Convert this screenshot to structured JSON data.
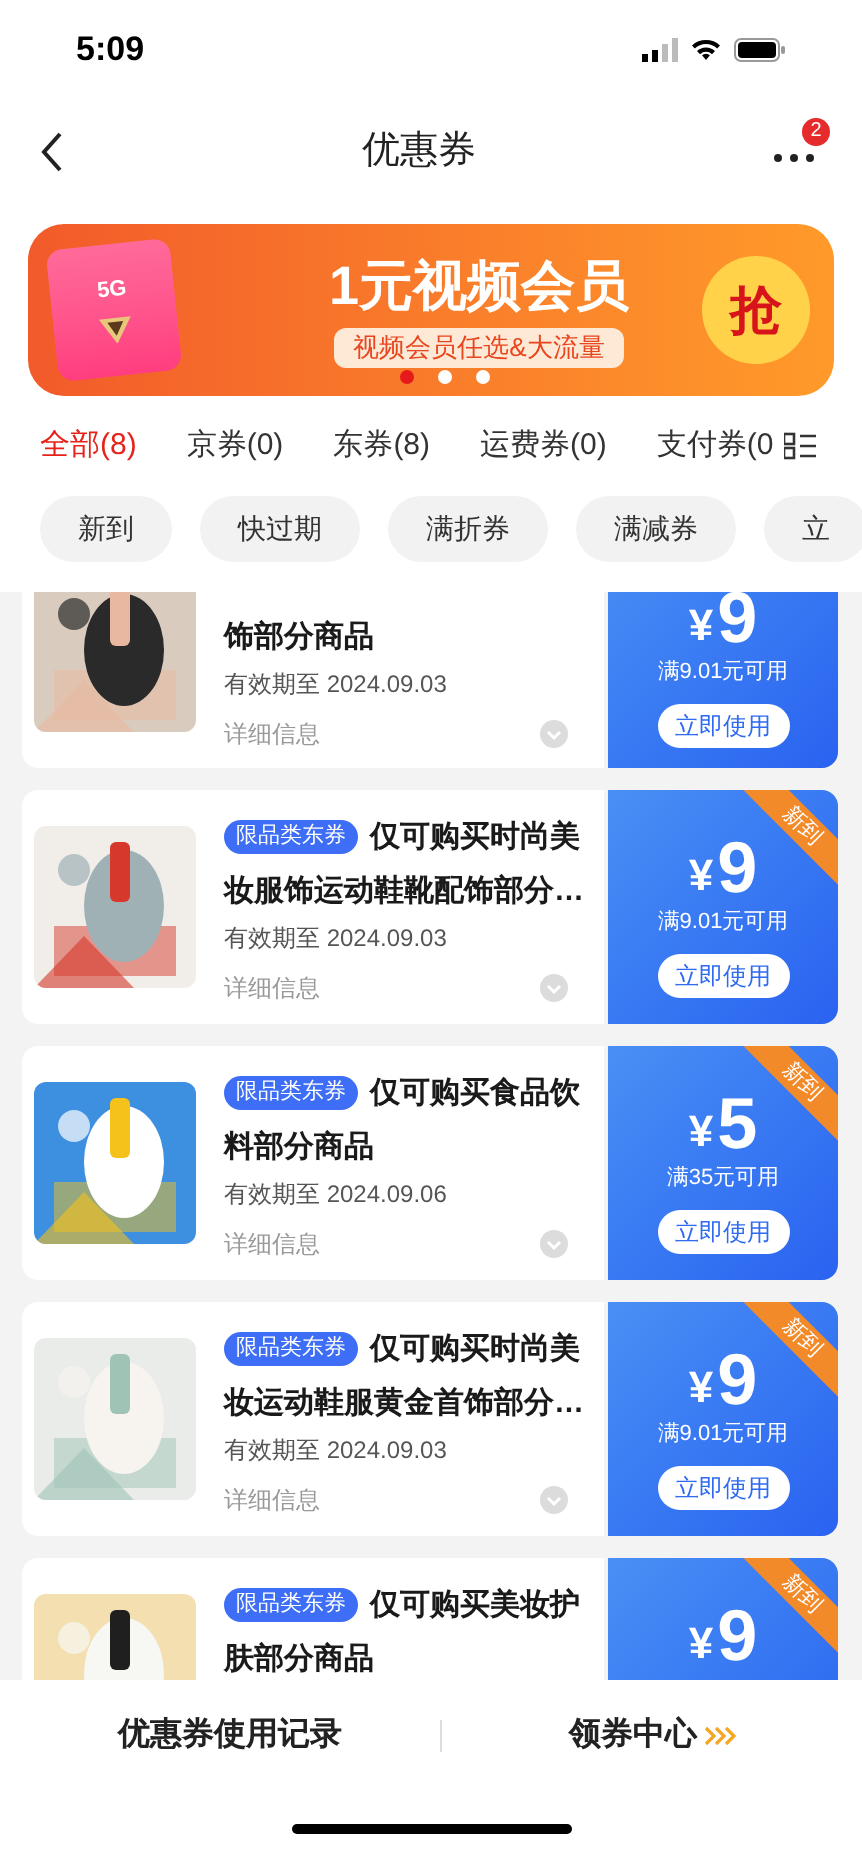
{
  "status_bar": {
    "time": "5:09"
  },
  "nav": {
    "title": "优惠券",
    "badge": "2"
  },
  "banner": {
    "headline": "1元视频会员",
    "subline": "视频会员任选&大流量",
    "action": "抢",
    "logo_text": "5G",
    "dots": [
      {
        "selected": true
      },
      {
        "selected": false
      },
      {
        "selected": false
      }
    ]
  },
  "tabs": [
    {
      "label": "全部(8)",
      "selected": true
    },
    {
      "label": "京券(0)",
      "selected": false
    },
    {
      "label": "东券(8)",
      "selected": false
    },
    {
      "label": "运费券(0)",
      "selected": false
    },
    {
      "label": "支付券(0",
      "selected": false
    }
  ],
  "filters": [
    {
      "label": "新到"
    },
    {
      "label": "快过期"
    },
    {
      "label": "满折券"
    },
    {
      "label": "满减券"
    },
    {
      "label": "立"
    }
  ],
  "coupons": [
    {
      "title": "饰部分商品",
      "expiry": "有效期至 2024.09.03",
      "details": "详细信息",
      "currency": "¥",
      "amount": "9",
      "condition": "满9.01元可用",
      "action": "立即使用",
      "is_new": false
    },
    {
      "tag": "限品类东券",
      "title": "仅可购买时尚美妆服饰运动鞋靴配饰部分…",
      "expiry": "有效期至 2024.09.03",
      "details": "详细信息",
      "currency": "¥",
      "amount": "9",
      "condition": "满9.01元可用",
      "action": "立即使用",
      "is_new": true,
      "new_label": "新到"
    },
    {
      "tag": "限品类东券",
      "title": "仅可购买食品饮料部分商品",
      "expiry": "有效期至 2024.09.06",
      "details": "详细信息",
      "currency": "¥",
      "amount": "5",
      "condition": "满35元可用",
      "action": "立即使用",
      "is_new": true,
      "new_label": "新到"
    },
    {
      "tag": "限品类东券",
      "title": "仅可购买时尚美妆运动鞋服黄金首饰部分…",
      "expiry": "有效期至 2024.09.03",
      "details": "详细信息",
      "currency": "¥",
      "amount": "9",
      "condition": "满9.01元可用",
      "action": "立即使用",
      "is_new": true,
      "new_label": "新到"
    },
    {
      "tag": "限品类东券",
      "title": "仅可购买美妆护肤部分商品",
      "currency": "¥",
      "amount": "9",
      "is_new": true,
      "new_label": "新到"
    }
  ],
  "bottom_bar": {
    "history": "优惠券使用记录",
    "center": "领券中心"
  }
}
